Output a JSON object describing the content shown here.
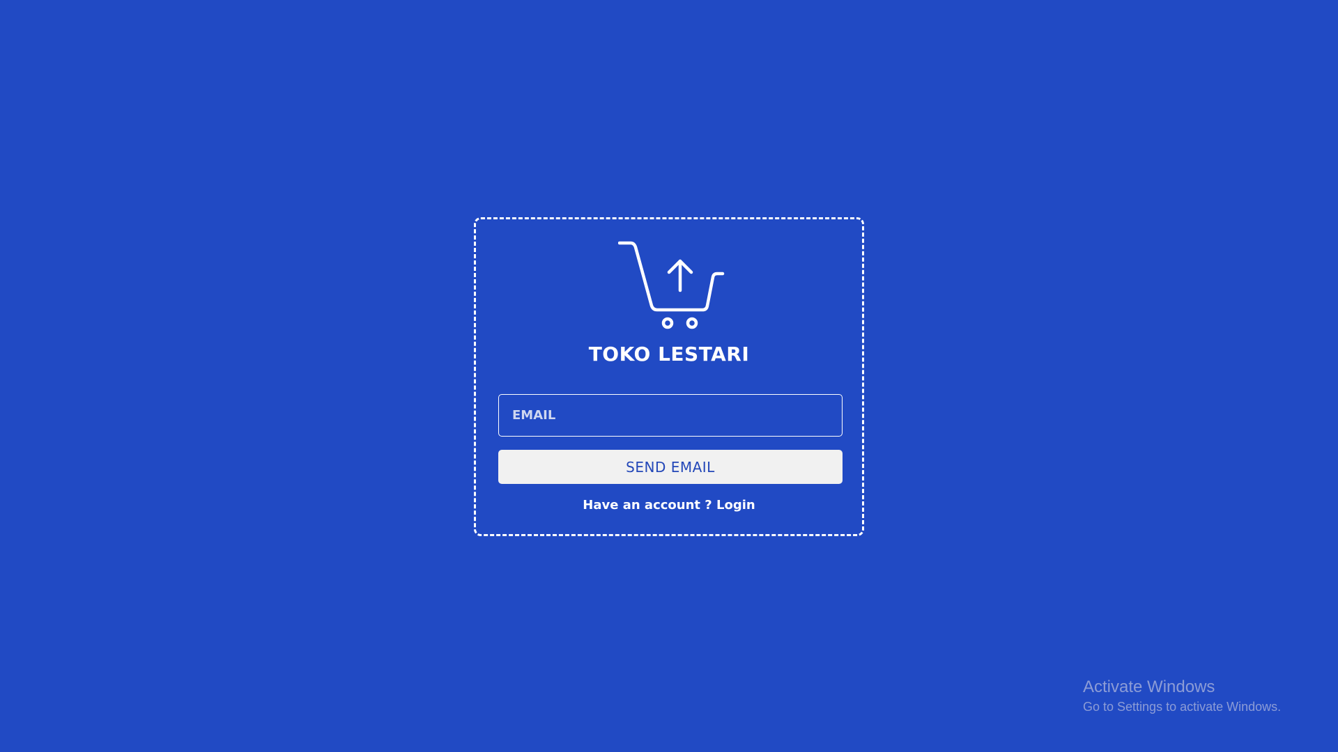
{
  "brand": {
    "name": "TOKO LESTARI",
    "logo_icon": "shopping-cart-upload-icon"
  },
  "form": {
    "email_placeholder": "EMAIL",
    "email_value": "",
    "send_button_label": "SEND EMAIL",
    "account_prompt": "Have an account ?",
    "login_link_label": "Login"
  },
  "watermark": {
    "title": "Activate Windows",
    "subtitle": "Go to Settings to activate Windows."
  },
  "colors": {
    "background": "#214ac4",
    "card_border": "#ffffff",
    "button_background": "#f1f1f1",
    "button_text": "#2347b8"
  }
}
